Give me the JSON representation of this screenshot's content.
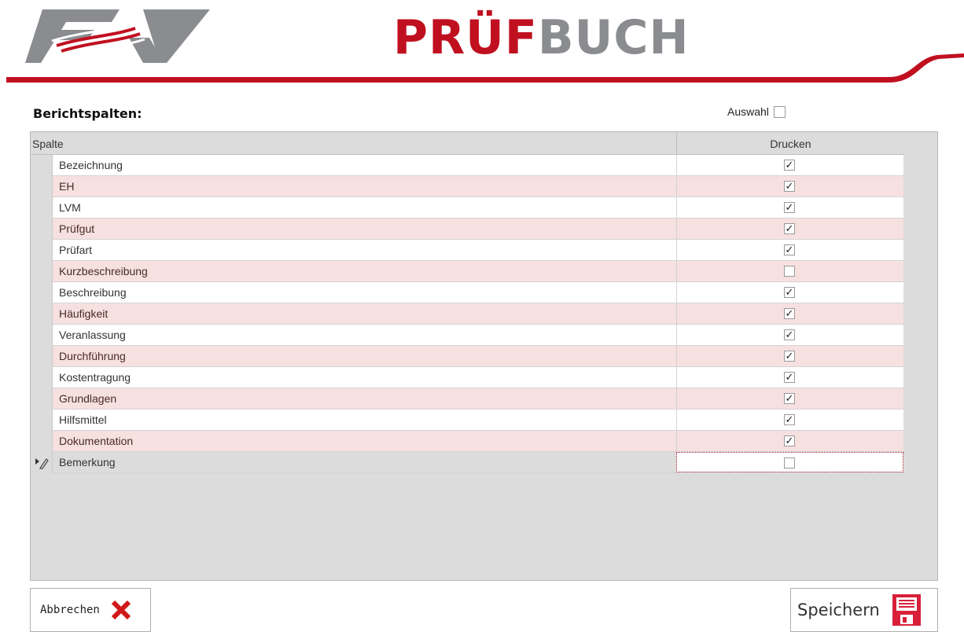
{
  "header": {
    "brand_part1": "P",
    "brand_part2": "RÜF",
    "brand_part3": "BUCH",
    "colors": {
      "accent_red": "#c01020",
      "logo_gray": "#8a8c8f"
    }
  },
  "section_title": "Berichtspalten:",
  "auswahl": {
    "label": "Auswahl",
    "checked": false
  },
  "grid": {
    "columns": [
      "Spalte",
      "Drucken"
    ],
    "rows": [
      {
        "name": "Bezeichnung",
        "checked": true
      },
      {
        "name": "EH",
        "checked": true
      },
      {
        "name": "LVM",
        "checked": true
      },
      {
        "name": "Prüfgut",
        "checked": true
      },
      {
        "name": "Prüfart",
        "checked": true
      },
      {
        "name": "Kurzbeschreibung",
        "checked": false
      },
      {
        "name": "Beschreibung",
        "checked": true
      },
      {
        "name": "Häufigkeit",
        "checked": true
      },
      {
        "name": "Veranlassung",
        "checked": true
      },
      {
        "name": "Durchführung",
        "checked": true
      },
      {
        "name": "Kostentragung",
        "checked": true
      },
      {
        "name": "Grundlagen",
        "checked": true
      },
      {
        "name": "Hilfsmittel",
        "checked": true
      },
      {
        "name": "Dokumentation",
        "checked": true
      },
      {
        "name": "Bemerkung",
        "checked": false
      }
    ],
    "row_colors": {
      "white": "#ffffff",
      "pink": "#f7e0e0"
    }
  },
  "buttons": {
    "cancel": {
      "label": "Abbrechen",
      "icon": "close-x-icon"
    },
    "save": {
      "label": "Speichern",
      "icon": "floppy-disk-icon"
    }
  }
}
